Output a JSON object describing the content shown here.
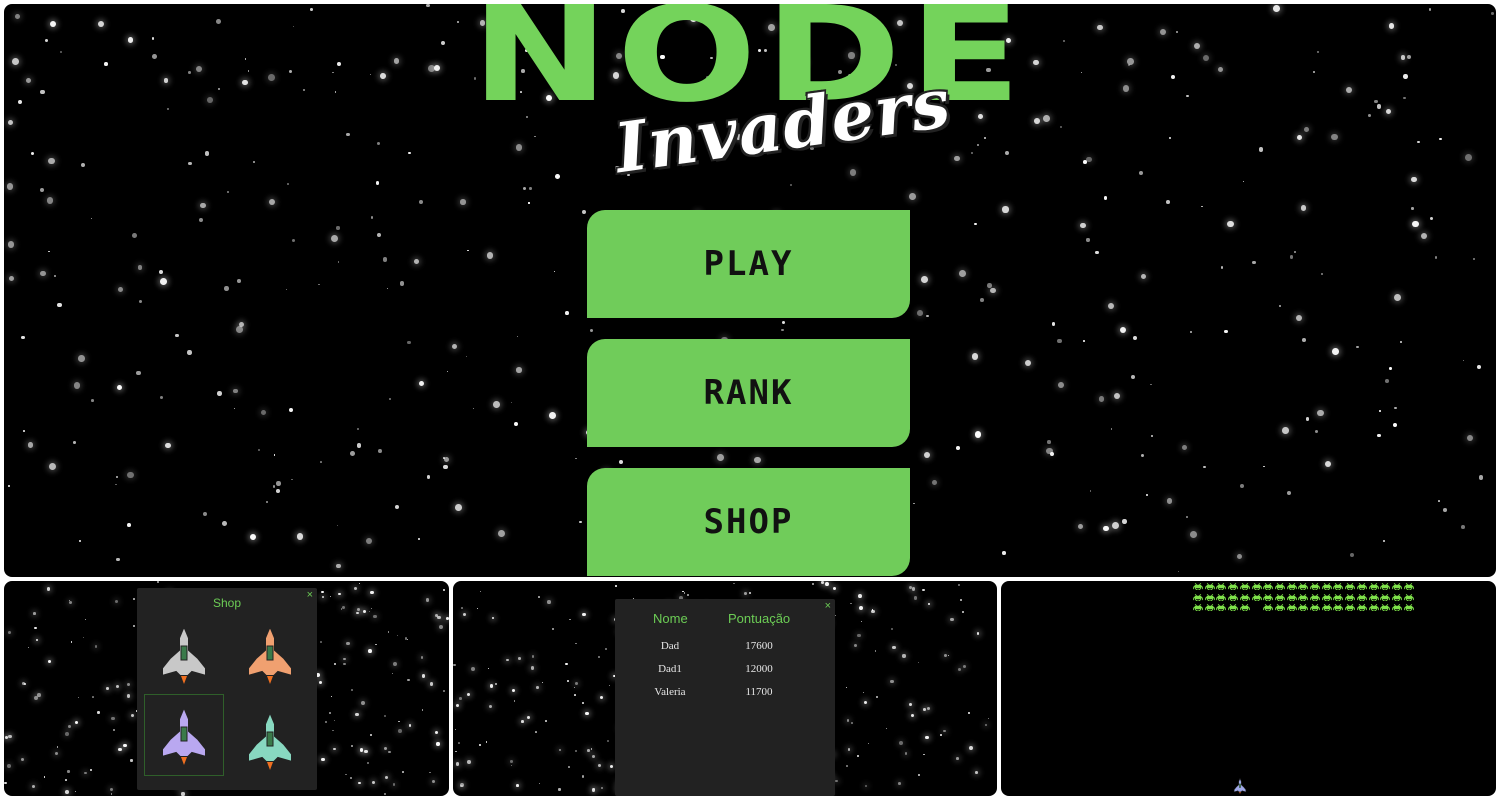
{
  "menu": {
    "logo_top": "NODE",
    "logo_bottom": "Invaders",
    "buttons": [
      {
        "label": "PLAY"
      },
      {
        "label": "RANK"
      },
      {
        "label": "SHOP"
      }
    ],
    "accent_color": "#70cc5a"
  },
  "shop": {
    "title": "Shop",
    "close": "×",
    "ships": [
      {
        "name": "silver-ship",
        "color": "#c8c8c8",
        "selected": false
      },
      {
        "name": "orange-ship",
        "color": "#f0a070",
        "selected": false
      },
      {
        "name": "purple-ship",
        "color": "#b9a8f0",
        "selected": true
      },
      {
        "name": "teal-ship",
        "color": "#88d8c0",
        "selected": false
      }
    ]
  },
  "rank": {
    "close": "×",
    "headers": [
      "Nome",
      "Pontuação"
    ],
    "rows": [
      {
        "name": "Dad",
        "score": "17600"
      },
      {
        "name": "Dad1",
        "score": "12000"
      },
      {
        "name": "Valeria",
        "score": "11700"
      }
    ]
  },
  "game": {
    "alien_color": "#7ee04a",
    "player_ship_color": "#9fa8e8"
  }
}
